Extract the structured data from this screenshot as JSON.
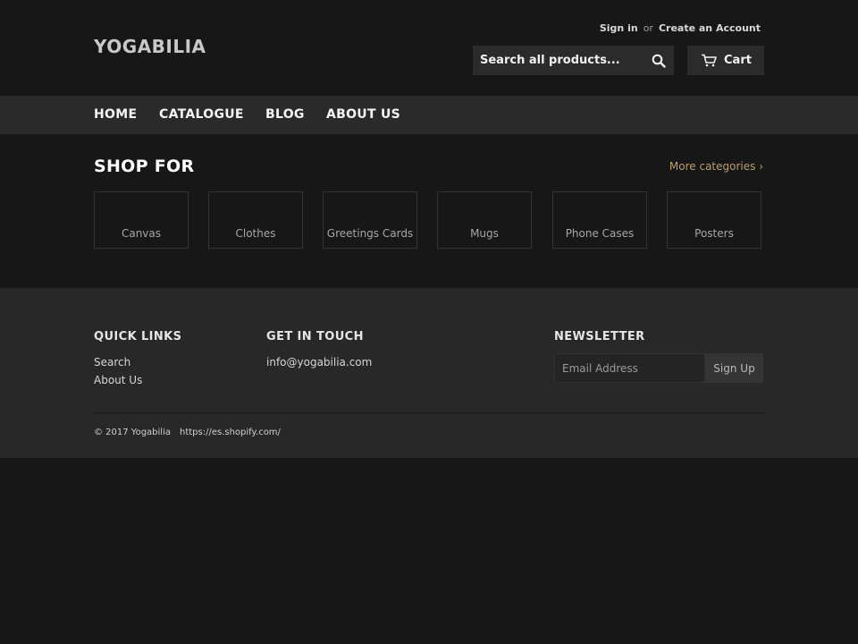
{
  "header": {
    "logo": "YOGABILIA",
    "sign_in": "Sign in",
    "or": "or",
    "create_account": "Create an Account",
    "search_placeholder": "Search all products...",
    "cart_label": "Cart"
  },
  "nav": {
    "items": [
      {
        "label": "HOME"
      },
      {
        "label": "CATALOGUE"
      },
      {
        "label": "BLOG"
      },
      {
        "label": "ABOUT US"
      }
    ]
  },
  "shop": {
    "title": "SHOP FOR",
    "more_link": "More categories ›",
    "categories": [
      {
        "label": "Canvas"
      },
      {
        "label": "Clothes"
      },
      {
        "label": "Greetings Cards"
      },
      {
        "label": "Mugs"
      },
      {
        "label": "Phone Cases"
      },
      {
        "label": "Posters"
      }
    ]
  },
  "footer": {
    "quick_links_title": "QUICK LINKS",
    "quick_links": [
      {
        "label": "Search"
      },
      {
        "label": "About Us"
      }
    ],
    "contact_title": "GET IN TOUCH",
    "contact_email": "info@yogabilia.com",
    "newsletter_title": "NEWSLETTER",
    "newsletter_placeholder": "Email Address",
    "signup_label": "Sign Up",
    "copyright": "© 2017 Yogabilia",
    "powered_link": "https://es.shopify.com/"
  },
  "colors": {
    "background": "#171717",
    "nav_bg": "#2a2a2a",
    "footer_bg": "#282828",
    "accent_link": "#b79f73"
  },
  "icons": {
    "search": "search-icon",
    "cart": "cart-icon"
  }
}
